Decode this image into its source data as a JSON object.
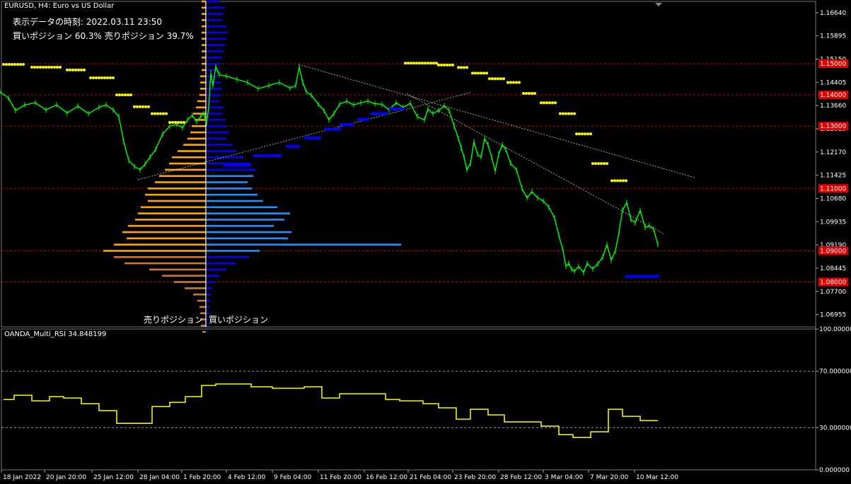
{
  "header": {
    "symbol_line": "EURUSD, H4:  Euro vs US Dollar",
    "time_line": "表示データの時刻: 2022.03.11 23:50",
    "position_line": "買いポジション 60.3% 売りポジション 39.7%"
  },
  "profile_labels": {
    "sell": "売りポジション",
    "buy": "買いポジション"
  },
  "rsi_label": "OANDA_Multi_RSI 34.848199",
  "colors": {
    "background": "#000000",
    "candle": "#00ff00",
    "axis_text": "#ffffff",
    "level_line": "#cc0000",
    "level_box": "#e00000",
    "yellow_dots": "#ffff00",
    "blue_dashes": "#0000ff",
    "sell_profile": "#ffa500",
    "sell_profile_dark": "#cd7a2c",
    "buy_profile": "#1e90ff",
    "buy_profile_dark": "#0000ff",
    "rsi_line": "#ffff00",
    "trendline": "#ffffff"
  },
  "chart_data": [
    {
      "type": "line",
      "title": "EURUSD, H4",
      "x_ticks": [
        "18 Jan 2022",
        "20 Jan 20:00",
        "25 Jan 12:00",
        "28 Jan 04:00",
        "1 Feb 20:00",
        "4 Feb 12:00",
        "9 Feb 04:00",
        "11 Feb 20:00",
        "16 Feb 12:00",
        "21 Feb 04:00",
        "23 Feb 20:00",
        "28 Feb 12:00",
        "3 Mar 04:00",
        "7 Mar 20:00",
        "10 Mar 12:00"
      ],
      "y_ticks": [
        "1.16640",
        "1.15895",
        "1.15150",
        "1.14405",
        "1.13660",
        "1.12915",
        "1.12170",
        "1.11425",
        "1.10680",
        "1.09935",
        "1.09190",
        "1.08445",
        "1.07700",
        "1.06955"
      ],
      "ylim": [
        1.0656,
        1.17
      ],
      "levels": [
        1.15,
        1.14,
        1.13,
        1.11,
        1.09,
        1.08
      ],
      "level_labels": [
        "1.15000",
        "1.14000",
        "1.13000",
        "1.11000",
        "1.09000",
        "1.08000"
      ],
      "price": {
        "x": [
          0,
          12,
          22,
          35,
          50,
          65,
          80,
          95,
          110,
          125,
          140,
          150,
          160,
          168,
          175,
          182,
          190,
          198,
          205,
          212,
          220,
          230,
          240,
          250,
          258,
          265,
          272,
          278,
          284,
          288,
          292,
          295,
          298,
          301,
          305,
          310,
          320,
          335,
          350,
          365,
          380,
          395,
          410,
          418,
          423,
          428,
          433,
          440,
          450,
          458,
          465,
          472,
          480,
          490,
          500,
          510,
          520,
          530,
          540,
          550,
          560,
          570,
          580,
          590,
          600,
          605,
          612,
          620,
          628,
          635,
          642,
          648,
          652,
          656,
          660,
          665,
          670,
          675,
          680,
          685,
          690,
          695,
          700,
          705,
          710,
          715,
          722,
          730,
          738,
          745,
          752,
          760,
          768,
          776,
          784,
          790,
          796,
          800,
          804,
          808,
          812,
          818,
          825,
          830,
          838,
          845,
          852,
          858,
          864,
          870,
          875,
          880,
          886,
          892,
          898,
          905,
          912,
          918,
          924,
          930
        ],
        "y": [
          1.141,
          1.139,
          1.135,
          1.1368,
          1.1375,
          1.1352,
          1.1368,
          1.1342,
          1.1364,
          1.134,
          1.136,
          1.1368,
          1.1352,
          1.133,
          1.125,
          1.119,
          1.117,
          1.116,
          1.1178,
          1.12,
          1.1225,
          1.1275,
          1.13,
          1.1305,
          1.1295,
          1.132,
          1.1335,
          1.1315,
          1.1332,
          1.134,
          1.131,
          1.136,
          1.147,
          1.143,
          1.149,
          1.1465,
          1.146,
          1.145,
          1.144,
          1.142,
          1.143,
          1.144,
          1.1422,
          1.143,
          1.149,
          1.144,
          1.141,
          1.14,
          1.137,
          1.135,
          1.132,
          1.134,
          1.137,
          1.138,
          1.1368,
          1.1375,
          1.138,
          1.1372,
          1.137,
          1.1352,
          1.1375,
          1.136,
          1.1373,
          1.133,
          1.132,
          1.1355,
          1.134,
          1.135,
          1.1365,
          1.135,
          1.13,
          1.126,
          1.123,
          1.12,
          1.116,
          1.118,
          1.125,
          1.121,
          1.12,
          1.126,
          1.124,
          1.12,
          1.1155,
          1.121,
          1.124,
          1.1225,
          1.118,
          1.116,
          1.11,
          1.107,
          1.109,
          1.107,
          1.106,
          1.104,
          1.1005,
          1.095,
          1.09,
          1.085,
          1.086,
          1.084,
          1.0835,
          1.085,
          1.083,
          1.086,
          1.0842,
          1.0858,
          1.088,
          1.092,
          1.087,
          1.09,
          1.096,
          1.103,
          1.1055,
          1.1,
          1.099,
          1.103,
          1.0975,
          1.098,
          1.097,
          1.092
        ]
      },
      "yellow_dots": [
        {
          "x0": 5,
          "x1": 35,
          "y": 1.1498
        },
        {
          "x0": 45,
          "x1": 85,
          "y": 1.1489
        },
        {
          "x0": 95,
          "x1": 120,
          "y": 1.148
        },
        {
          "x0": 128,
          "x1": 160,
          "y": 1.1455
        },
        {
          "x0": 165,
          "x1": 188,
          "y": 1.14
        },
        {
          "x0": 190,
          "x1": 212,
          "y": 1.1362
        },
        {
          "x0": 215,
          "x1": 235,
          "y": 1.134
        },
        {
          "x0": 240,
          "x1": 260,
          "y": 1.1312
        },
        {
          "x0": 573,
          "x1": 618,
          "y": 1.1502
        },
        {
          "x0": 620,
          "x1": 642,
          "y": 1.1496
        },
        {
          "x0": 648,
          "x1": 662,
          "y": 1.1488
        },
        {
          "x0": 668,
          "x1": 690,
          "y": 1.147
        },
        {
          "x0": 692,
          "x1": 712,
          "y": 1.1452
        },
        {
          "x0": 718,
          "x1": 735,
          "y": 1.144
        },
        {
          "x0": 740,
          "x1": 758,
          "y": 1.1405
        },
        {
          "x0": 765,
          "x1": 785,
          "y": 1.1375
        },
        {
          "x0": 792,
          "x1": 812,
          "y": 1.134
        },
        {
          "x0": 815,
          "x1": 835,
          "y": 1.1275
        },
        {
          "x0": 838,
          "x1": 858,
          "y": 1.118
        },
        {
          "x0": 865,
          "x1": 885,
          "y": 1.1125
        }
      ],
      "blue_dashes": [
        {
          "x0": 316,
          "x1": 355,
          "y": 1.1175
        },
        {
          "x0": 358,
          "x1": 398,
          "y": 1.1205
        },
        {
          "x0": 404,
          "x1": 424,
          "y": 1.1235
        },
        {
          "x0": 430,
          "x1": 454,
          "y": 1.1262
        },
        {
          "x0": 458,
          "x1": 482,
          "y": 1.129
        },
        {
          "x0": 480,
          "x1": 500,
          "y": 1.1305
        },
        {
          "x0": 505,
          "x1": 522,
          "y": 1.1322
        },
        {
          "x0": 524,
          "x1": 548,
          "y": 1.134
        },
        {
          "x0": 550,
          "x1": 572,
          "y": 1.1355
        },
        {
          "x0": 884,
          "x1": 932,
          "y": 1.0818
        }
      ],
      "trendlines": [
        {
          "x1": 422,
          "y1": 1.1498,
          "x2": 982,
          "y2": 1.1135
        },
        {
          "x1": 195,
          "y1": 1.1128,
          "x2": 665,
          "y2": 1.1408
        },
        {
          "x1": 575,
          "y1": 1.1405,
          "x2": 938,
          "y2": 1.0955
        }
      ],
      "profile_center_x": 291,
      "profile": {
        "sell": [
          [
            1.17,
            6
          ],
          [
            1.168,
            6
          ],
          [
            1.166,
            6
          ],
          [
            1.164,
            6
          ],
          [
            1.162,
            6
          ],
          [
            1.16,
            6
          ],
          [
            1.158,
            6
          ],
          [
            1.156,
            6
          ],
          [
            1.154,
            6
          ],
          [
            1.152,
            6
          ],
          [
            1.15,
            6
          ],
          [
            1.148,
            6
          ],
          [
            1.146,
            8
          ],
          [
            1.144,
            8
          ],
          [
            1.142,
            8
          ],
          [
            1.14,
            9
          ],
          [
            1.138,
            12
          ],
          [
            1.136,
            14
          ],
          [
            1.134,
            18
          ],
          [
            1.132,
            16
          ],
          [
            1.13,
            20
          ],
          [
            1.128,
            22
          ],
          [
            1.126,
            26
          ],
          [
            1.124,
            32
          ],
          [
            1.122,
            40
          ],
          [
            1.12,
            48
          ],
          [
            1.118,
            52
          ],
          [
            1.116,
            58
          ],
          [
            1.114,
            66
          ],
          [
            1.112,
            72
          ],
          [
            1.11,
            82
          ],
          [
            1.108,
            86
          ],
          [
            1.106,
            82
          ],
          [
            1.104,
            92
          ],
          [
            1.102,
            96
          ],
          [
            1.1,
            100
          ],
          [
            1.098,
            110
          ],
          [
            1.096,
            118
          ],
          [
            1.094,
            112
          ],
          [
            1.092,
            130
          ],
          [
            1.09,
            145
          ],
          [
            1.088,
            130
          ],
          [
            1.086,
            115
          ],
          [
            1.084,
            80
          ],
          [
            1.082,
            62
          ],
          [
            1.08,
            45
          ],
          [
            1.078,
            30
          ],
          [
            1.076,
            18
          ],
          [
            1.074,
            12
          ],
          [
            1.072,
            9
          ],
          [
            1.07,
            8
          ],
          [
            1.068,
            8
          ],
          [
            1.066,
            7
          ],
          [
            1.064,
            5
          ]
        ],
        "buy": [
          [
            1.17,
            18
          ],
          [
            1.168,
            26
          ],
          [
            1.166,
            24
          ],
          [
            1.164,
            22
          ],
          [
            1.162,
            28
          ],
          [
            1.16,
            30
          ],
          [
            1.158,
            28
          ],
          [
            1.156,
            26
          ],
          [
            1.154,
            24
          ],
          [
            1.152,
            22
          ],
          [
            1.15,
            20
          ],
          [
            1.148,
            18
          ],
          [
            1.146,
            16
          ],
          [
            1.144,
            20
          ],
          [
            1.142,
            22
          ],
          [
            1.14,
            20
          ],
          [
            1.138,
            18
          ],
          [
            1.136,
            24
          ],
          [
            1.134,
            22
          ],
          [
            1.132,
            26
          ],
          [
            1.13,
            28
          ],
          [
            1.128,
            32
          ],
          [
            1.126,
            28
          ],
          [
            1.124,
            36
          ],
          [
            1.122,
            42
          ],
          [
            1.12,
            52
          ],
          [
            1.118,
            62
          ],
          [
            1.116,
            70
          ],
          [
            1.114,
            66
          ],
          [
            1.112,
            58
          ],
          [
            1.11,
            64
          ],
          [
            1.108,
            72
          ],
          [
            1.106,
            80
          ],
          [
            1.104,
            100
          ],
          [
            1.102,
            118
          ],
          [
            1.1,
            110
          ],
          [
            1.098,
            95
          ],
          [
            1.096,
            120
          ],
          [
            1.094,
            115
          ],
          [
            1.092,
            275
          ],
          [
            1.09,
            75
          ],
          [
            1.088,
            60
          ],
          [
            1.086,
            42
          ],
          [
            1.084,
            28
          ],
          [
            1.082,
            18
          ],
          [
            1.08,
            12
          ],
          [
            1.078,
            8
          ],
          [
            1.076,
            6
          ],
          [
            1.074,
            5
          ],
          [
            1.072,
            4
          ],
          [
            1.07,
            3
          ],
          [
            1.068,
            3
          ],
          [
            1.066,
            3
          ],
          [
            1.064,
            2
          ]
        ]
      }
    },
    {
      "type": "line",
      "title": "OANDA_Multi_RSI 34.848199",
      "y_ticks": [
        "100.000000",
        "70.000000",
        "30.000000",
        "0.000000"
      ],
      "ylim": [
        0,
        100
      ],
      "levels": [
        70,
        30
      ],
      "x": [
        5,
        20,
        45,
        70,
        90,
        115,
        140,
        165,
        185,
        210,
        215,
        240,
        262,
        285,
        305,
        355,
        385,
        430,
        455,
        480,
        505,
        545,
        565,
        598,
        620,
        645,
        665,
        690,
        713,
        740,
        765,
        790,
        810,
        835,
        860,
        880,
        905,
        930
      ],
      "values": [
        50,
        53,
        49,
        52,
        51,
        47,
        42,
        33,
        33,
        33,
        45,
        48,
        52,
        60,
        61,
        59,
        58,
        59,
        51,
        54,
        54,
        50,
        49,
        47,
        44,
        36,
        43,
        39,
        34,
        34,
        31,
        25,
        23,
        27,
        43,
        38,
        35,
        35
      ]
    }
  ]
}
